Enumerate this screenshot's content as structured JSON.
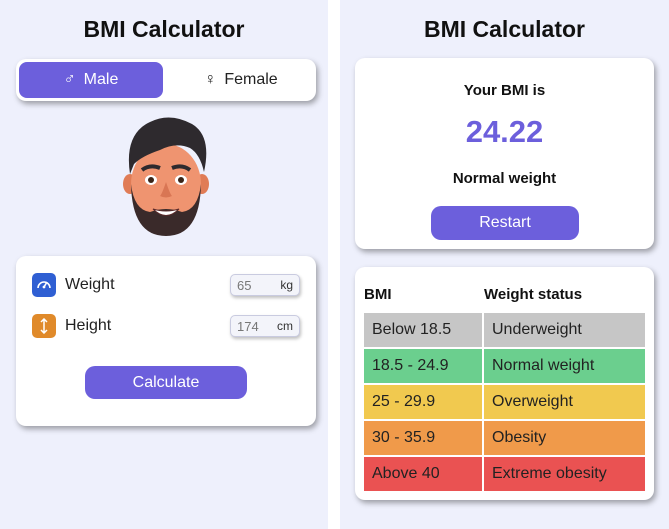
{
  "left": {
    "title": "BMI Calculator",
    "gender": {
      "male_label": "Male",
      "female_label": "Female",
      "male_icon": "male-symbol-icon",
      "female_icon": "female-symbol-icon",
      "selected": "male"
    },
    "weight": {
      "label": "Weight",
      "value": "65",
      "unit": "kg",
      "icon": "gauge-icon"
    },
    "height": {
      "label": "Height",
      "value": "174",
      "unit": "cm",
      "icon": "vertical-arrows-icon"
    },
    "calculate_label": "Calculate"
  },
  "right": {
    "title": "BMI Calculator",
    "result_heading": "Your BMI is",
    "bmi_value": "24.22",
    "status": "Normal weight",
    "restart_label": "Restart",
    "table": {
      "headers": [
        "BMI",
        "Weight status"
      ],
      "rows": [
        {
          "bmi": "Below 18.5",
          "status": "Underweight",
          "color": "#c6c6c6"
        },
        {
          "bmi": "18.5 - 24.9",
          "status": "Normal weight",
          "color": "#6bcf8e"
        },
        {
          "bmi": "25 - 29.9",
          "status": "Overweight",
          "color": "#f1c94f"
        },
        {
          "bmi": "30 - 35.9",
          "status": "Obesity",
          "color": "#f09a4a"
        },
        {
          "bmi": "Above 40",
          "status": "Extreme obesity",
          "color": "#ea5252"
        }
      ]
    }
  },
  "colors": {
    "accent": "#6c5fdc",
    "background": "#eef0fc",
    "weight_icon": "#2f5fd3",
    "height_icon": "#e08a2a"
  }
}
